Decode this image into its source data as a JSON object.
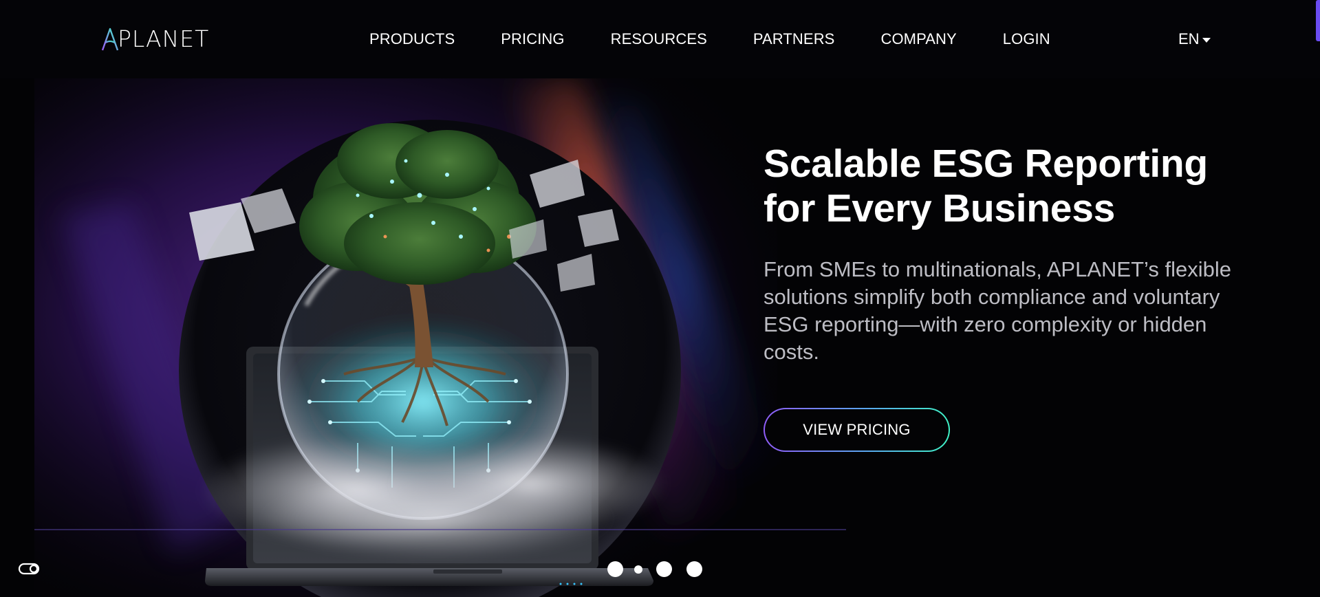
{
  "brand": {
    "name": "APLANET",
    "accent_start": "#9a5cf6",
    "accent_end": "#3ff2c6"
  },
  "nav": {
    "items": [
      {
        "label": "PRODUCTS"
      },
      {
        "label": "PRICING"
      },
      {
        "label": "RESOURCES"
      },
      {
        "label": "PARTNERS"
      },
      {
        "label": "COMPANY"
      },
      {
        "label": "LOGIN"
      }
    ],
    "language": "EN"
  },
  "hero": {
    "title": "Scalable ESG Reporting for Every Business",
    "description": "From SMEs to multinationals, APLANET’s flexible solutions simplify both compliance and voluntary ESG reporting—with zero complexity or hidden costs.",
    "cta_label": "VIEW PRICING",
    "illustration": "tree-in-glass-globe-on-laptop"
  },
  "carousel": {
    "slides": 4,
    "active": 2
  },
  "icons": {
    "language_caret": "caret-down-icon",
    "privacy": "cookie-preferences-icon"
  }
}
